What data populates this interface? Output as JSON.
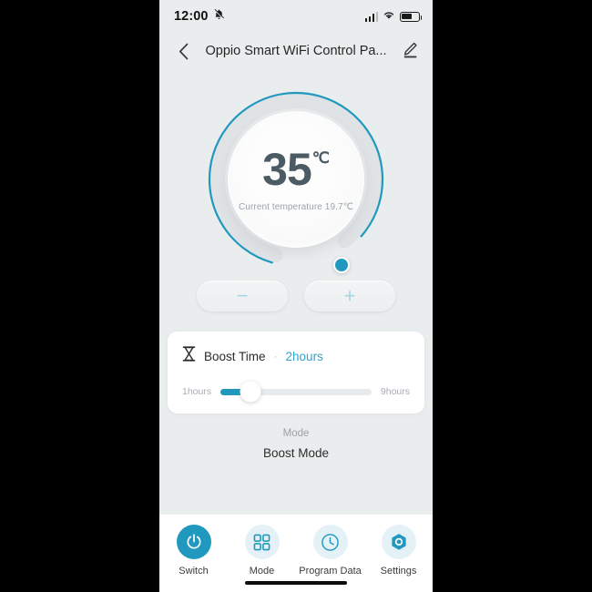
{
  "colors": {
    "accent": "#2199bf",
    "accent_light": "#2fa3cc",
    "app_bg": "#eaedee",
    "card_bg": "#ffffff",
    "text_dark": "#2b2b2b",
    "text_muted": "#9aa0a5",
    "dial_text": "#4c5a63",
    "pm_glyph": "#a8d4e4"
  },
  "status_bar": {
    "time": "12:00",
    "bell_icon": "bell-muted-icon",
    "signal_icon": "signal-bars-icon",
    "wifi_icon": "wifi-icon",
    "battery_icon": "battery-icon",
    "battery_level": "62"
  },
  "title_bar": {
    "back_icon": "chevron-left-icon",
    "title": "Oppio Smart WiFi Control Pa...",
    "edit_icon": "edit-pencil-icon"
  },
  "dial": {
    "target_temp": "35",
    "unit": "℃",
    "current_temp_label": "Current temperature 19.7℃",
    "arc_progress_pct": "82",
    "knob_icon": "dial-knob"
  },
  "stepper": {
    "minus_label": "−",
    "plus_label": "+",
    "minus_icon": "minus-icon",
    "plus_icon": "plus-icon"
  },
  "boost_card": {
    "icon": "hourglass-icon",
    "title": "Boost Time",
    "separator": "·",
    "value": "2hours",
    "slider": {
      "min_label": "1hours",
      "max_label": "9hours",
      "min": "1",
      "max": "9",
      "current": "2",
      "fill_pct": "20"
    }
  },
  "mode_section": {
    "label": "Mode",
    "value": "Boost Mode"
  },
  "bottom_nav": {
    "items": [
      {
        "label": "Switch",
        "icon": "power-icon",
        "active": true
      },
      {
        "label": "Mode",
        "icon": "grid-squares-icon",
        "active": false
      },
      {
        "label": "Program Data",
        "icon": "clock-icon",
        "active": false
      },
      {
        "label": "Settings",
        "icon": "hexagon-gear-icon",
        "active": false
      }
    ],
    "home_indicator": "home-indicator-bar"
  }
}
